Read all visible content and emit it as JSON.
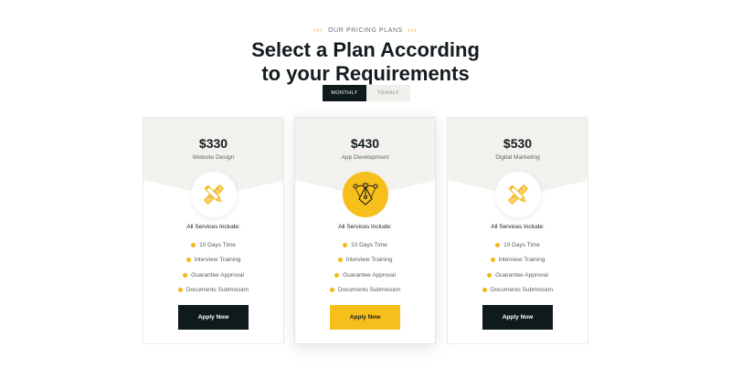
{
  "header": {
    "eyebrow": "OUR PRICING PLANS",
    "eyebrow_arrows": "›››",
    "title_line1": "Select a Plan According",
    "title_line2": "to your Requirements"
  },
  "toggle": {
    "monthly": "MONTHLY",
    "yearly": "YEARLY",
    "selected": "monthly"
  },
  "colors": {
    "accent": "#f7bf1c",
    "dark": "#0f1a1c",
    "card_top": "#f2f1ed"
  },
  "plans": [
    {
      "price": "$330",
      "name": "Website Design",
      "icon": "pencil-ruler-icon",
      "includes_label": "All Services Include:",
      "features": [
        "10 Days Time",
        "Interview Training",
        "Guarantee Approval",
        "Documents Submission"
      ],
      "button": "Apply Now"
    },
    {
      "price": "$430",
      "name": "App Development",
      "icon": "bezier-pen-icon",
      "includes_label": "All Services Include:",
      "features": [
        "10 Days Time",
        "Interview Training",
        "Guarantee Approval",
        "Documents Submission"
      ],
      "button": "Apply Now"
    },
    {
      "price": "$530",
      "name": "Digital Marketing",
      "icon": "pencil-ruler-icon",
      "includes_label": "All Services Include:",
      "features": [
        "10 Days Time",
        "Interview Training",
        "Guarantee Approval",
        "Documents Submission"
      ],
      "button": "Apply Now"
    }
  ]
}
